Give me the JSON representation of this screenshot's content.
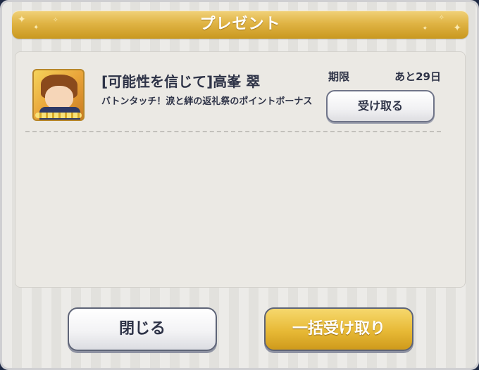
{
  "dialog": {
    "title": "プレゼント"
  },
  "present_list": {
    "items": [
      {
        "name": "[可能性を信じて]高峯 翠",
        "description": "バトンタッチ！涙と絆の返礼祭のポイントボーナス",
        "deadline_label": "期限",
        "deadline_value": "あと29日",
        "receive_label": "受け取る",
        "thumbnail_icon": "card-thumbnail-image"
      }
    ]
  },
  "footer": {
    "close_label": "閉じる",
    "receive_all_label": "一括受け取り"
  },
  "colors": {
    "accent_gold": "#e0b445",
    "text_dark": "#2e3347"
  }
}
